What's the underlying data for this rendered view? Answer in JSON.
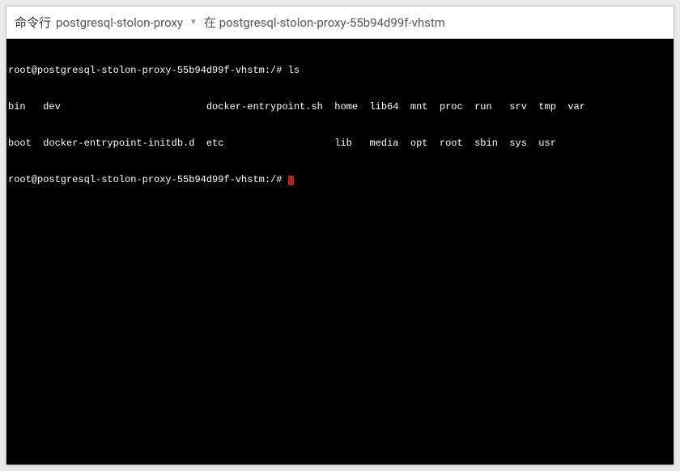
{
  "header": {
    "title": "命令行",
    "app": "postgresql-stolon-proxy",
    "sub": "在 postgresql-stolon-proxy-55b94d99f-vhstm"
  },
  "terminal": {
    "prompt1": "root@postgresql-stolon-proxy-55b94d99f-vhstm:/# ",
    "command": "ls",
    "ls_row1": "bin   dev                         docker-entrypoint.sh  home  lib64  mnt  proc  run   srv  tmp  var",
    "ls_row2": "boot  docker-entrypoint-initdb.d  etc                   lib   media  opt  root  sbin  sys  usr",
    "prompt2": "root@postgresql-stolon-proxy-55b94d99f-vhstm:/# "
  }
}
